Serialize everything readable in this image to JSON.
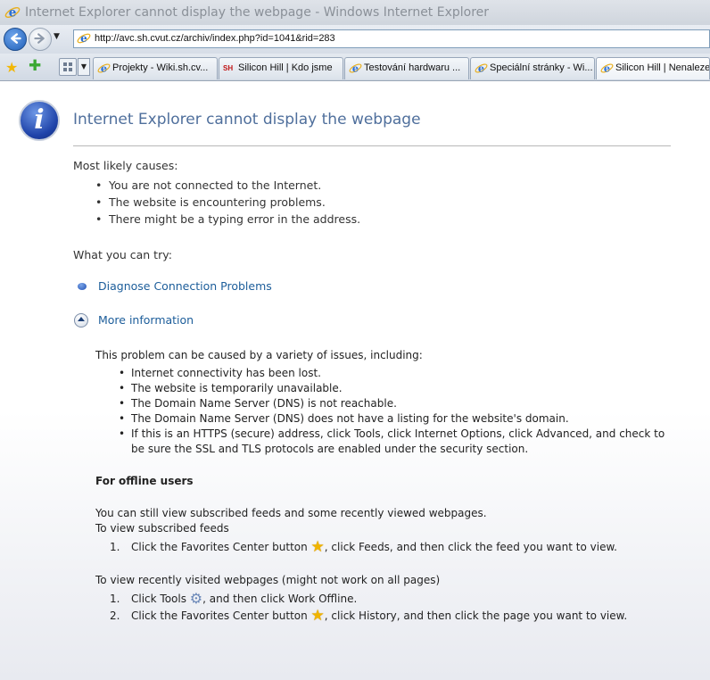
{
  "window": {
    "title": "Internet Explorer cannot display the webpage - Windows Internet Explorer"
  },
  "address_bar": {
    "url": "http://avc.sh.cvut.cz/archiv/index.php?id=1041&rid=283"
  },
  "tabs": [
    {
      "label": "Projekty - Wiki.sh.cv...",
      "icon": "ie-icon"
    },
    {
      "label": "Silicon Hill | Kdo jsme",
      "icon": "sh-icon"
    },
    {
      "label": "Testování hardwaru ...",
      "icon": "ie-icon"
    },
    {
      "label": "Speciální stránky - Wi...",
      "icon": "ie-icon"
    },
    {
      "label": "Silicon Hill | Nenalezeno",
      "icon": "ie-icon"
    }
  ],
  "page": {
    "title": "Internet Explorer cannot display the webpage",
    "causes_label": "Most likely causes:",
    "causes": [
      "You are not connected to the Internet.",
      "The website is encountering problems.",
      "There might be a typing error in the address."
    ],
    "try_label": "What you can try:",
    "diagnose_link": "Diagnose Connection Problems",
    "more_info_link": "More information",
    "more_intro": "This problem can be caused by a variety of issues, including:",
    "issues": [
      "Internet connectivity has been lost.",
      "The website is temporarily unavailable.",
      "The Domain Name Server (DNS) is not reachable.",
      "The Domain Name Server (DNS) does not have a listing for the website's domain.",
      "If this is an HTTPS (secure) address, click Tools, click Internet Options, click Advanced, and check to be sure the SSL and TLS protocols are enabled under the security section."
    ],
    "offline_heading": "For offline users",
    "offline_intro": "You can still view subscribed feeds and some recently viewed webpages.",
    "feeds_label": "To view subscribed feeds",
    "feeds_step1_num": "1.",
    "feeds_step1_a": "Click the Favorites Center button",
    "feeds_step1_b": ", click Feeds, and then click the feed you want to view.",
    "recent_label": "To view recently visited webpages (might not work on all pages)",
    "recent_step1_num": "1.",
    "recent_step1_a": "Click Tools",
    "recent_step1_b": ", and then click Work Offline.",
    "recent_step2_num": "2.",
    "recent_step2_a": "Click the Favorites Center button",
    "recent_step2_b": ", click History, and then click the page you want to view."
  },
  "colors": {
    "link": "#1c5d9a",
    "title": "#4f6f9c"
  }
}
